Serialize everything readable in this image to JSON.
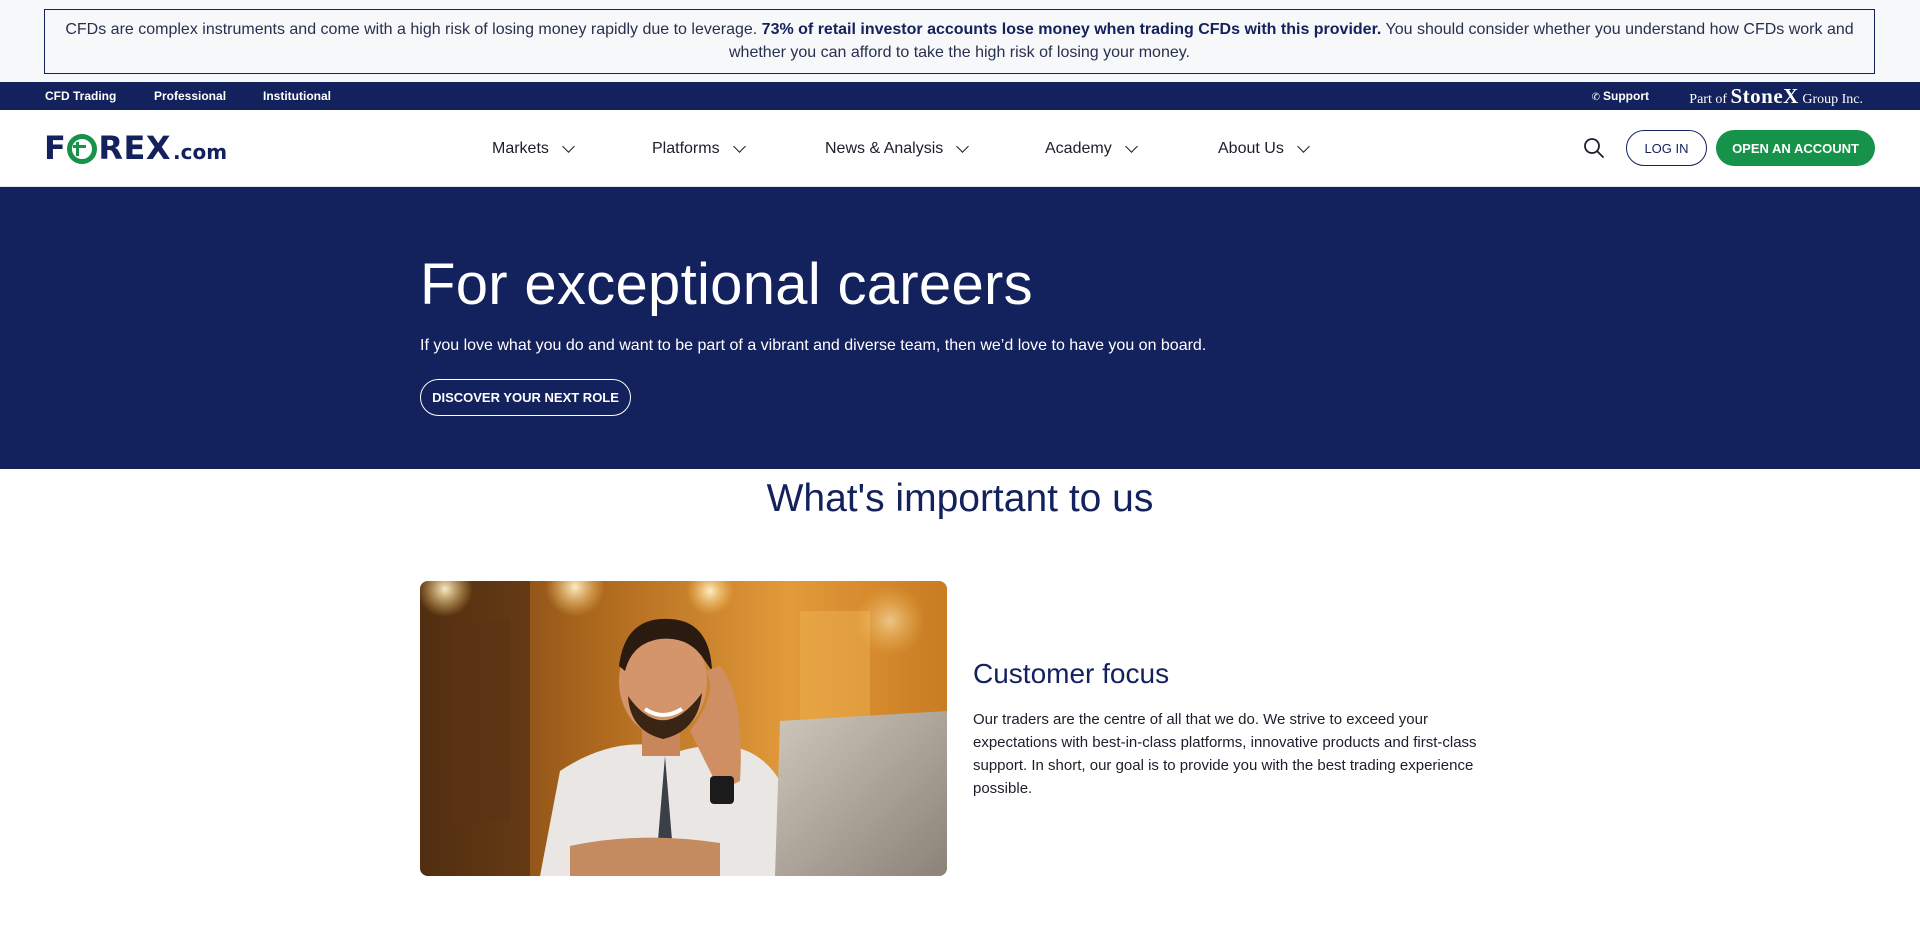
{
  "risk_warning": {
    "text_before": "CFDs are complex instruments and come with a high risk of losing money rapidly due to leverage. ",
    "text_bold": "73% of retail investor accounts lose money when trading CFDs with this provider.",
    "text_after": " You should consider whether you understand how CFDs work and whether you can afford to take the high risk of losing your money."
  },
  "utility_bar": {
    "links": [
      "CFD Trading",
      "Professional",
      "Institutional"
    ],
    "support": "Support",
    "group_prefix": "Part of",
    "group_brand": "StoneX",
    "group_suffix": "Group Inc."
  },
  "logo": {
    "f": "F",
    "rex": "REX",
    "com": ".com"
  },
  "nav": {
    "items": [
      "Markets",
      "Platforms",
      "News & Analysis",
      "Academy",
      "About Us"
    ],
    "login": "LOG IN",
    "open_account": "OPEN AN ACCOUNT"
  },
  "hero": {
    "title": "For exceptional careers",
    "subtitle": "If you love what you do and want to be part of a vibrant and diverse team, then we’d love to have you on board.",
    "cta": "DISCOVER YOUR NEXT ROLE"
  },
  "values": {
    "title": "What's important to us",
    "card": {
      "title": "Customer focus",
      "text": "Our traders are the centre of all that we do. We strive to exceed your expectations with best-in-class platforms, innovative products and first-class support. In short, our goal is to provide you with the best trading experience possible."
    }
  },
  "colors": {
    "navy": "#13215c",
    "green": "#17924a",
    "banner_bg": "#f7f8fa"
  },
  "icons": [
    "search-icon",
    "phone-icon",
    "chevron-down-icon"
  ]
}
